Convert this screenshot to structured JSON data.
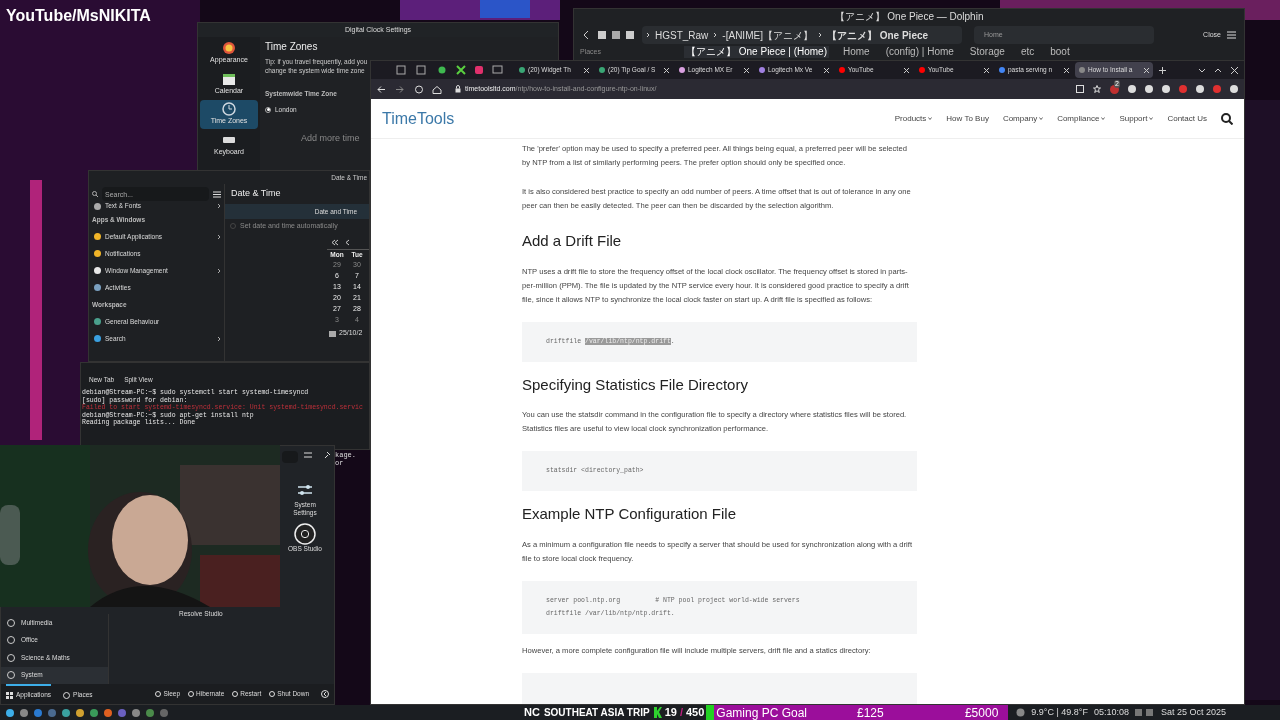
{
  "overlay": {
    "channel": "YouTube/MsNIKITA"
  },
  "clock_settings": {
    "title": "Digital Clock Settings",
    "sidebar": [
      {
        "label": "Appearance",
        "selected": false
      },
      {
        "label": "Calendar",
        "selected": false
      },
      {
        "label": "Time Zones",
        "selected": true
      },
      {
        "label": "Keyboard",
        "selected": false
      }
    ],
    "heading": "Time Zones",
    "tip": "Tip: if you travel frequently, add you change the system wide time zone",
    "section": "Systemwide Time Zone",
    "zones": [
      {
        "label": "London",
        "selected": true
      }
    ],
    "add_more": "Add more time"
  },
  "dolphin": {
    "title": "【アニメ】 One Piece — Dolphin",
    "breadcrumb": [
      "HGST_Raw",
      "-[ANIME]【アニメ】",
      "【アニメ】 One Piece"
    ],
    "location": "Home",
    "close": "Close",
    "places": "Places",
    "tabs": [
      {
        "label": "【アニメ】 One Piece | (Home)",
        "selected": true
      },
      {
        "label": "Home",
        "selected": false
      },
      {
        "label": "(config) | Home",
        "selected": false
      },
      {
        "label": "Storage",
        "selected": false
      },
      {
        "label": "etc",
        "selected": false
      },
      {
        "label": "boot",
        "selected": false
      }
    ]
  },
  "system_settings": {
    "title": "Date & Time",
    "search_placeholder": "Search...",
    "heading": "Date & Time",
    "sidebar": [
      {
        "kind": "item",
        "label": "Text & Fonts",
        "arrow": true
      },
      {
        "kind": "section",
        "label": "Apps & Windows"
      },
      {
        "kind": "item",
        "label": "Default Applications",
        "arrow": true
      },
      {
        "kind": "item",
        "label": "Notifications",
        "arrow": false
      },
      {
        "kind": "item",
        "label": "Window Management",
        "arrow": true
      },
      {
        "kind": "item",
        "label": "Activities",
        "arrow": false
      },
      {
        "kind": "section",
        "label": "Workspace"
      },
      {
        "kind": "item",
        "label": "General Behaviour",
        "arrow": false
      },
      {
        "kind": "item",
        "label": "Search",
        "arrow": true
      }
    ],
    "tab": "Date and Time",
    "auto": {
      "label": "Set date and time automatically",
      "checked": false,
      "disabled": true
    },
    "calendar": {
      "headers": [
        "Mon",
        "Tue"
      ],
      "rows": [
        [
          {
            "day": "29",
            "muted": true
          },
          {
            "day": "30",
            "muted": true
          }
        ],
        [
          {
            "day": "6",
            "muted": false
          },
          {
            "day": "7",
            "muted": false
          }
        ],
        [
          {
            "day": "13",
            "muted": false
          },
          {
            "day": "14",
            "muted": false
          }
        ],
        [
          {
            "day": "20",
            "muted": false
          },
          {
            "day": "21",
            "muted": false
          }
        ],
        [
          {
            "day": "27",
            "muted": false
          },
          {
            "day": "28",
            "muted": false
          }
        ],
        [
          {
            "day": "3",
            "muted": true
          },
          {
            "day": "4",
            "muted": true
          }
        ]
      ]
    },
    "date_field": "25/10/2"
  },
  "terminal": {
    "tabs": [
      "New Tab",
      "Split View"
    ],
    "lines": [
      {
        "kind": "normal",
        "text": "debian@Stream-PC:~$ sudo systemctl start systemd-timesyncd"
      },
      {
        "kind": "normal",
        "text": "[sudo] password for debian:"
      },
      {
        "kind": "error",
        "text": "Failed to start systemd-timesyncd.service: Unit systemd-timesyncd.servic"
      },
      {
        "kind": "normal",
        "text": "debian@Stream-PC:~$ sudo apt-get install ntp"
      },
      {
        "kind": "normal",
        "text": "Reading package lists... Done"
      }
    ],
    "fragments": [
      "kage.",
      "or"
    ]
  },
  "launcher": {
    "categories": [
      {
        "label": "Multimedia",
        "selected": false
      },
      {
        "label": "Office",
        "selected": false
      },
      {
        "label": "Science & Maths",
        "selected": false
      },
      {
        "label": "System",
        "selected": true
      }
    ],
    "apps": [
      {
        "label": "System Settings"
      },
      {
        "label": "OBS Studio"
      }
    ],
    "app_under_video": "Resolve Studio",
    "footer_tabs": [
      {
        "label": "Applications",
        "selected": true
      },
      {
        "label": "Places",
        "selected": false
      }
    ],
    "power": [
      "Sleep",
      "Hibernate",
      "Restart",
      "Shut Down"
    ]
  },
  "browser": {
    "tabs": [
      {
        "label": "(20) Widget Th",
        "selected": false
      },
      {
        "label": "(20) Tip Goal / S",
        "selected": false
      },
      {
        "label": "Logitech MX Er",
        "selected": false
      },
      {
        "label": "Logitech Mx Ve",
        "selected": false
      },
      {
        "label": "YouTube",
        "selected": false
      },
      {
        "label": "YouTube",
        "selected": false
      },
      {
        "label": "pasta serving n",
        "selected": false
      },
      {
        "label": "How to Install a",
        "selected": true
      }
    ],
    "url_host": "timetoolsltd.com",
    "url_path": "/ntp/how-to-install-and-configure-ntp-on-linux/",
    "badge": "2",
    "site": {
      "logo": "TimeTools",
      "nav": [
        {
          "label": "Products",
          "dropdown": true
        },
        {
          "label": "How To Buy",
          "dropdown": false
        },
        {
          "label": "Company",
          "dropdown": true
        },
        {
          "label": "Compliance",
          "dropdown": true
        },
        {
          "label": "Support",
          "dropdown": true
        },
        {
          "label": "Contact Us",
          "dropdown": false
        }
      ]
    },
    "content": [
      {
        "kind": "p",
        "text": "The 'prefer' option may be used to specify a preferred peer. All things being equal, a preferred peer will be selected by NTP from a list of similarly performing peers. The prefer option should only be specified once."
      },
      {
        "kind": "p",
        "text": "It is also considered best practice to specify an odd number of peers. A time offset that is out of tolerance in any one peer can then be easily detected. The peer can then be discarded by the selection algorithm."
      },
      {
        "kind": "h2",
        "text": "Add a Drift File"
      },
      {
        "kind": "p",
        "text": "NTP uses a drift file to store the frequency offset of the local clock oscillator. The frequency offset is stored in parts-per-million (PPM). The file is updated by the NTP service every hour. It is considered good practice to specify a drift file, since it allows NTP to synchronize the local clock faster on start up. A drift file is specified as follows:"
      },
      {
        "kind": "code",
        "lines": [
          [
            {
              "text": "driftfile ",
              "selected": false
            },
            {
              "text": "/var/lib/ntp/ntp.drift",
              "selected": true
            },
            {
              "text": ".",
              "selected": false
            }
          ]
        ]
      },
      {
        "kind": "h2",
        "text": "Specifying Statistics File Directory"
      },
      {
        "kind": "p",
        "text": "You can use the statsdir command in the configuration file to specify a directory where statistics files will be stored. Statistics files are useful to view local clock synchronization performance."
      },
      {
        "kind": "code",
        "lines": [
          [
            {
              "text": "statsdir <directory_path>",
              "selected": false
            }
          ]
        ]
      },
      {
        "kind": "h2",
        "text": "Example NTP Configuration File"
      },
      {
        "kind": "p",
        "text": "As a minimum a configuration file needs to specify a server that should be used for synchronization along with a drift file to store local clock frequency."
      },
      {
        "kind": "code",
        "lines": [
          [
            {
              "text": "server pool.ntp.org         # NTP pool project world-wide servers",
              "selected": false
            }
          ],
          [
            {
              "text": "driftfile /var/lib/ntp/ntp.drift.",
              "selected": false
            }
          ]
        ]
      },
      {
        "kind": "p",
        "text": "However, a more complete configuration file will include multiple servers, drift file and a statics directory:"
      },
      {
        "kind": "code_cut"
      }
    ]
  },
  "taskbar": {
    "ticker": {
      "prefix": "NC",
      "trip": "SOUTHEAT ASIA TRIP",
      "trip_count": "19",
      "trip_sep": "/",
      "trip_total": "450",
      "goal": "Gaming PC Goal",
      "goal_amount": "£125",
      "goal_target": "£5000",
      "level": 0.025
    },
    "weather": "9.9°C | 49.8°F",
    "time": "05:10:08",
    "date": "Sat 25 Oct 2025"
  }
}
